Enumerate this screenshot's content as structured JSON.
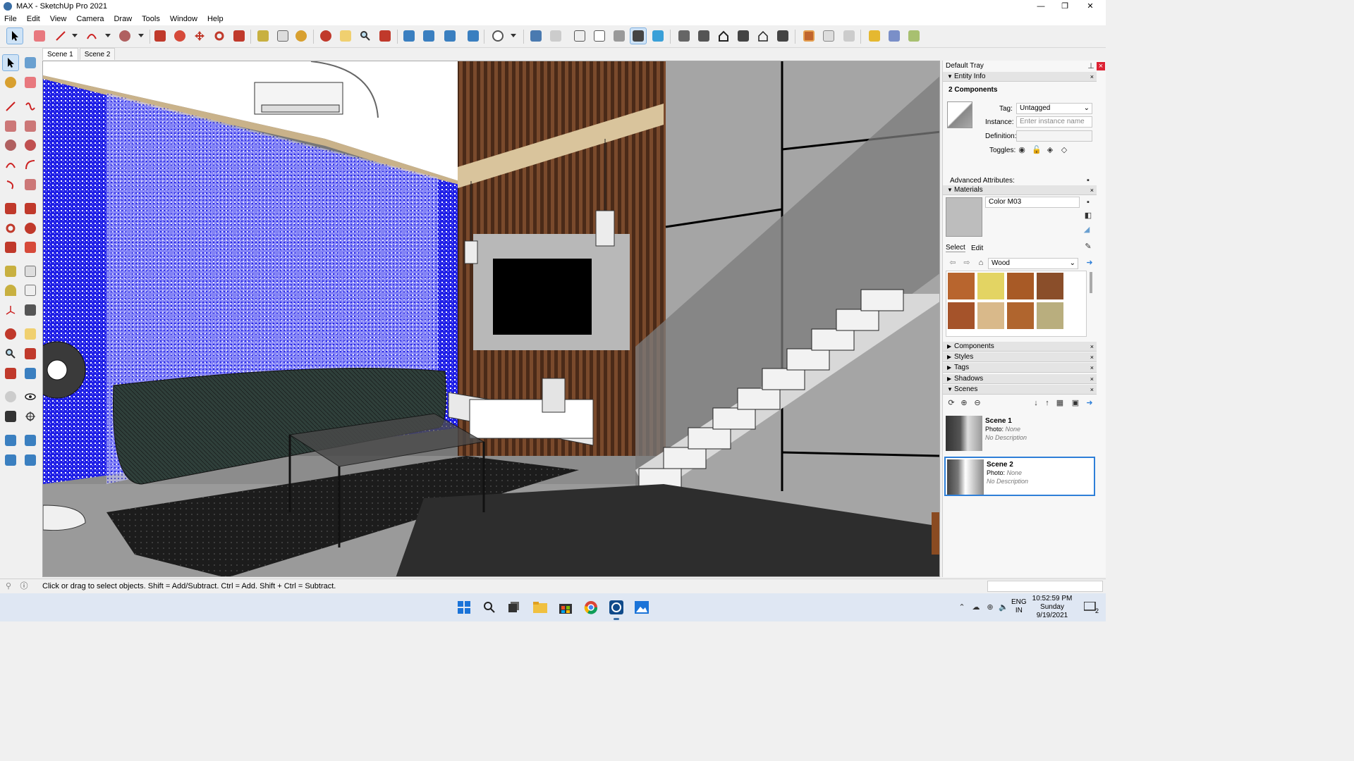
{
  "window": {
    "title": "MAX - SketchUp Pro 2021",
    "controls": [
      "—",
      "❐",
      "✕"
    ]
  },
  "menu": [
    "File",
    "Edit",
    "View",
    "Camera",
    "Draw",
    "Tools",
    "Window",
    "Help"
  ],
  "scene_tabs": [
    {
      "label": "Scene 1",
      "active": true
    },
    {
      "label": "Scene 2",
      "active": false
    }
  ],
  "tray": {
    "title": "Default Tray",
    "entity_info": {
      "header": "Entity Info",
      "selection": "2 Components",
      "tag_label": "Tag:",
      "tag_value": "Untagged",
      "instance_label": "Instance:",
      "instance_placeholder": "Enter instance name",
      "definition_label": "Definition:",
      "toggles_label": "Toggles:",
      "advanced_label": "Advanced Attributes:"
    },
    "materials": {
      "header": "Materials",
      "material_name": "Color M03",
      "tab_select": "Select",
      "tab_edit": "Edit",
      "library": "Wood",
      "swatches": [
        "#b8652e",
        "#e3d463",
        "#a85a26",
        "#8a4e2a",
        "#a5532a",
        "#d9b98a",
        "#b0652e",
        "#b9ae7e"
      ]
    },
    "panels": [
      "Components",
      "Styles",
      "Tags",
      "Shadows"
    ],
    "scenes": {
      "header": "Scenes",
      "items": [
        {
          "name": "Scene 1",
          "photo_label": "Photo:",
          "photo": "None",
          "description": "No Description",
          "selected": false
        },
        {
          "name": "Scene 2",
          "photo_label": "Photo:",
          "photo": "None",
          "description": "No Description",
          "selected": true
        }
      ]
    }
  },
  "status": {
    "message": "Click or drag to select objects. Shift = Add/Subtract. Ctrl = Add. Shift + Ctrl = Subtract."
  },
  "taskbar": {
    "lang_line1": "ENG",
    "lang_line2": "IN",
    "time": "10:52:59 PM",
    "day": "Sunday",
    "date": "9/19/2021",
    "notification_count": "2"
  },
  "colors": {
    "accent": "#2e7fd8",
    "curtain": "#1f1fe6",
    "wood_slat": "#5a3520",
    "marble": "#9a9a9a"
  }
}
